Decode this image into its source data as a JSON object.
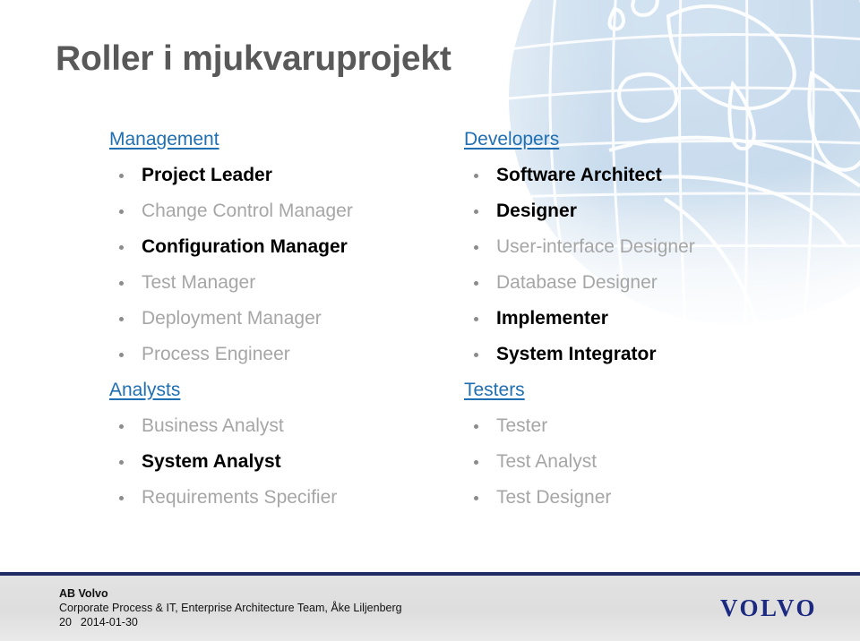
{
  "slide": {
    "title": "Roller i mjukvaruprojekt",
    "title_color": "#595959",
    "heading_color": "#1F6FB2",
    "highlight_color": "#000000",
    "muted_color": "#A6A6A6",
    "bullet_color": "#8C8C8C",
    "rule_color": "#1F2C66",
    "logo_color": "#1B2A80"
  },
  "columns": [
    {
      "name": "left",
      "groups": [
        {
          "heading": "Management",
          "items": [
            {
              "label": "Project Leader",
              "emphasis": "highlight"
            },
            {
              "label": "Change Control Manager",
              "emphasis": "muted"
            },
            {
              "label": "Configuration Manager",
              "emphasis": "highlight"
            },
            {
              "label": "Test Manager",
              "emphasis": "muted"
            },
            {
              "label": "Deployment Manager",
              "emphasis": "muted"
            },
            {
              "label": "Process Engineer",
              "emphasis": "muted"
            }
          ]
        },
        {
          "heading": "Analysts",
          "items": [
            {
              "label": "Business Analyst",
              "emphasis": "muted"
            },
            {
              "label": "System Analyst",
              "emphasis": "highlight"
            },
            {
              "label": "Requirements Specifier",
              "emphasis": "muted"
            }
          ]
        }
      ]
    },
    {
      "name": "right",
      "groups": [
        {
          "heading": "Developers",
          "items": [
            {
              "label": "Software Architect",
              "emphasis": "highlight"
            },
            {
              "label": "Designer",
              "emphasis": "highlight"
            },
            {
              "label": "User-interface Designer",
              "emphasis": "muted"
            },
            {
              "label": "Database Designer",
              "emphasis": "muted"
            },
            {
              "label": "Implementer",
              "emphasis": "highlight"
            },
            {
              "label": "System Integrator",
              "emphasis": "highlight"
            }
          ]
        },
        {
          "heading": "Testers",
          "items": [
            {
              "label": "Tester",
              "emphasis": "muted"
            },
            {
              "label": "Test Analyst",
              "emphasis": "muted"
            },
            {
              "label": "Test Designer",
              "emphasis": "muted"
            }
          ]
        }
      ]
    }
  ],
  "footer": {
    "organisation": "AB Volvo",
    "team": "Corporate Process & IT, Enterprise Architecture Team, Åke Liljenberg",
    "page_number": "20",
    "date": "2014-01-30",
    "logo_text": "VOLVO"
  },
  "decoration": {
    "watermark": "globe-world-map-watermark"
  }
}
